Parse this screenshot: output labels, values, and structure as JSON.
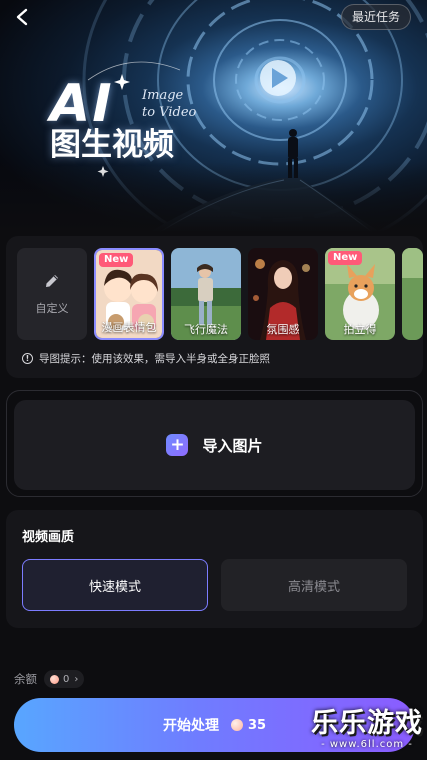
{
  "header": {
    "recent_tasks_label": "最近任务"
  },
  "hero": {
    "title_ai": "AI",
    "title_cn": "图生视频",
    "subtitle_line1": "Image",
    "subtitle_line2": "to Video"
  },
  "effects": {
    "items": [
      {
        "label": "自定义",
        "icon": "pencil-icon"
      },
      {
        "label": "漫画表情包",
        "badge": "New",
        "selected": true
      },
      {
        "label": "飞行魔法"
      },
      {
        "label": "氛围感"
      },
      {
        "label": "拍立得",
        "badge": "New"
      }
    ],
    "hint": "导图提示：使用该效果，需导入半身或全身正脸照"
  },
  "upload": {
    "label": "导入图片"
  },
  "quality": {
    "title": "视频画质",
    "modes": [
      {
        "label": "快速模式",
        "selected": true
      },
      {
        "label": "高清模式",
        "selected": false
      }
    ]
  },
  "balance": {
    "label": "余额",
    "value": "0"
  },
  "start": {
    "label": "开始处理",
    "cost": "35"
  },
  "watermark": {
    "big": "乐乐游戏",
    "small": "- www.6ll.com -"
  },
  "colors": {
    "accent": "#7c7cff",
    "new_badge": "#ff5a78",
    "start_gradient_left": "#58a6ff",
    "start_gradient_right": "#8b5cff"
  }
}
